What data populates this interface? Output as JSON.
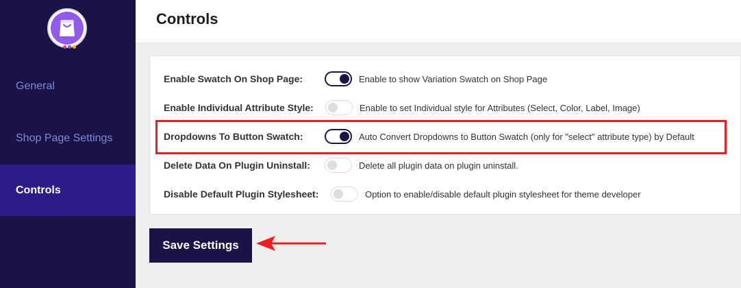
{
  "sidebar": {
    "items": [
      {
        "label": "General",
        "active": false
      },
      {
        "label": "Shop Page Settings",
        "active": false
      },
      {
        "label": "Controls",
        "active": true
      }
    ]
  },
  "header": {
    "title": "Controls"
  },
  "settings": [
    {
      "label": "Enable Swatch On Shop Page:",
      "enabled": true,
      "description": "Enable to show Variation Swatch on Shop Page"
    },
    {
      "label": "Enable Individual Attribute Style:",
      "enabled": false,
      "description": "Enable to set Individual style for Attributes (Select, Color, Label, Image)"
    },
    {
      "label": "Dropdowns To Button Swatch:",
      "enabled": true,
      "description": "Auto Convert Dropdowns to Button Swatch (only for \"select\" attribute type) by Default"
    },
    {
      "label": "Delete Data On Plugin Uninstall:",
      "enabled": false,
      "description": "Delete all plugin data on plugin uninstall."
    },
    {
      "label": "Disable Default Plugin Stylesheet:",
      "enabled": false,
      "description": "Option to enable/disable default plugin stylesheet for theme developer"
    }
  ],
  "save_label": "Save Settings",
  "colors": {
    "sidebar": "#1b1346",
    "sidebar_active": "#2c1c88",
    "accent": "#1b1346",
    "annotation": "#ef1f1f"
  },
  "icons": {
    "logo": "shopping-bag-icon",
    "annotation_arrow": "arrow-left-icon"
  }
}
